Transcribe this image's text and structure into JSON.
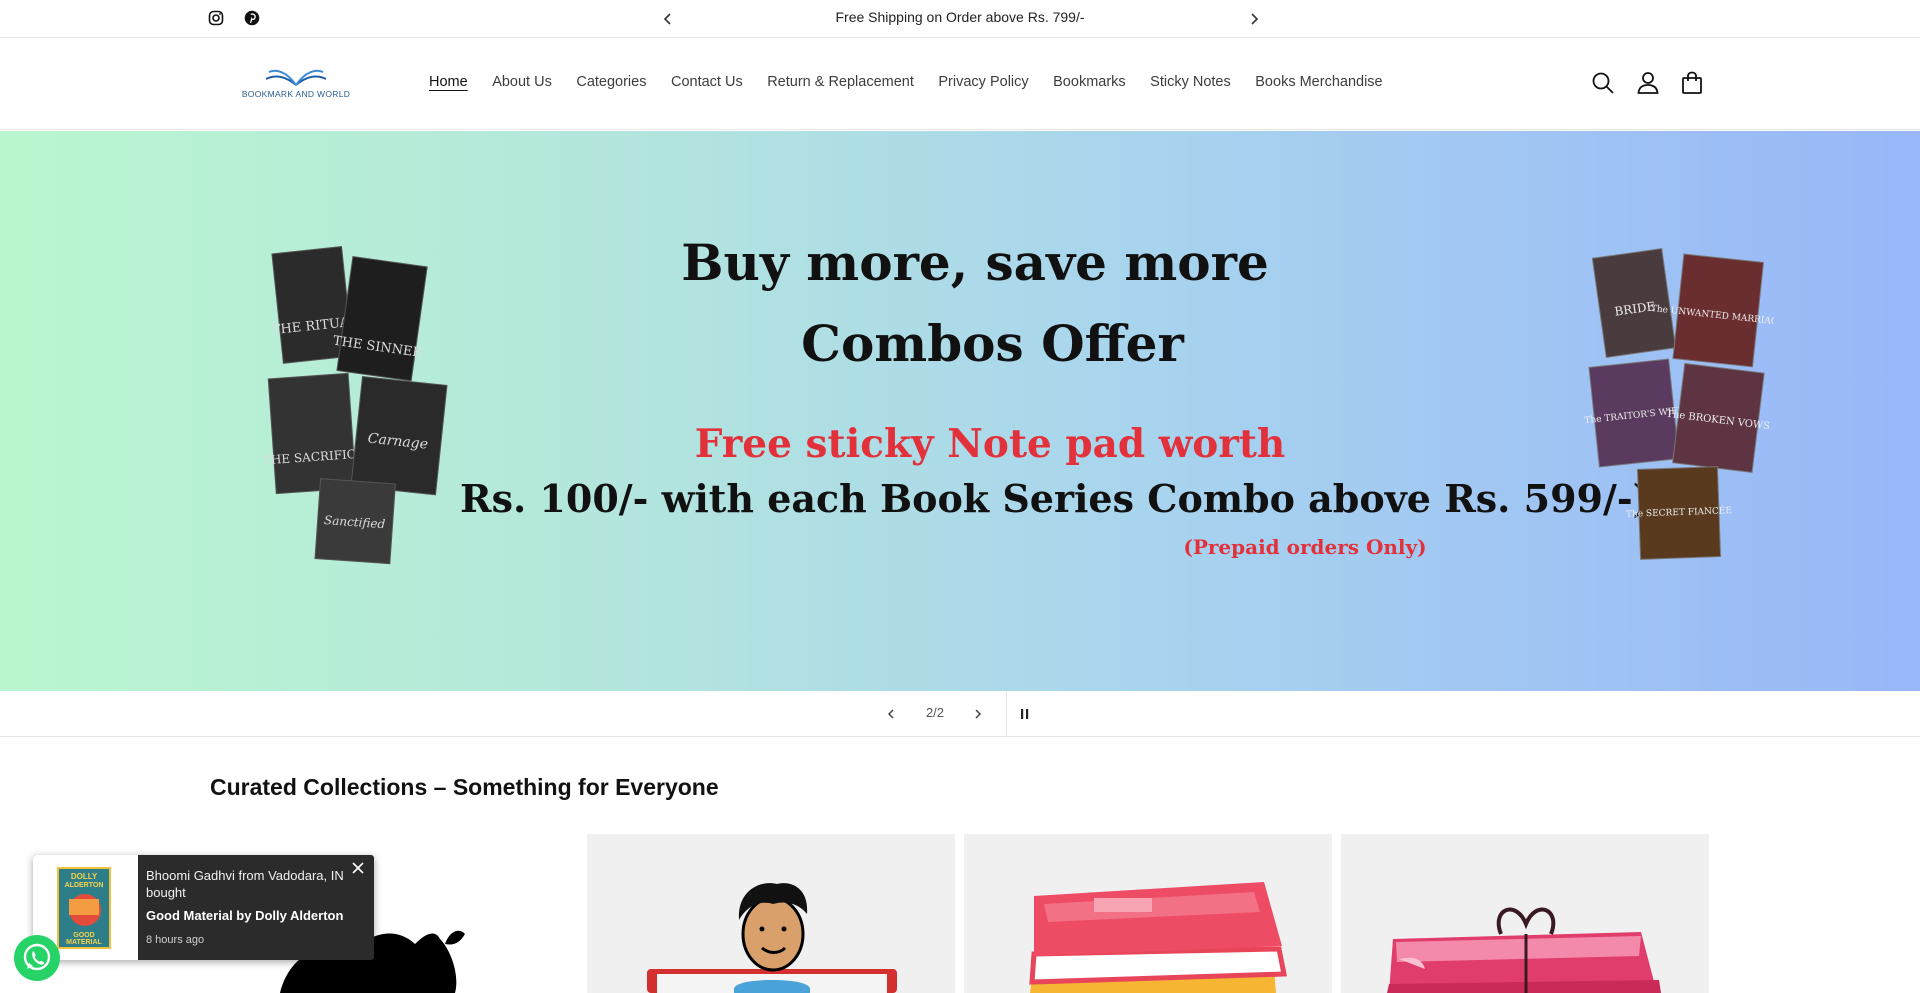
{
  "announcement": {
    "text": "Free Shipping on Order above Rs. 799/-",
    "social": [
      "instagram-icon",
      "pinterest-icon"
    ]
  },
  "header": {
    "logo_text": "BOOKMARK AND WORLD",
    "nav": [
      {
        "label": "Home",
        "active": true
      },
      {
        "label": "About Us"
      },
      {
        "label": "Categories"
      },
      {
        "label": "Contact Us"
      },
      {
        "label": "Return & Replacement"
      },
      {
        "label": "Privacy Policy"
      },
      {
        "label": "Bookmarks"
      },
      {
        "label": "Sticky Notes"
      },
      {
        "label": "Books Merchandise"
      }
    ],
    "icons": [
      "search-icon",
      "account-icon",
      "cart-icon"
    ]
  },
  "banner": {
    "line1": "Buy more, save more",
    "line2": "Combos Offer",
    "line3": "Free sticky Note pad worth",
    "line4": "Rs. 100/- with each Book Series Combo above Rs. 599/-)",
    "line5": "(Prepaid orders Only)",
    "left_books": [
      "THE RITUAL",
      "THE SINNER",
      "THE SACRIFICE",
      "Carnage",
      "Sanctified"
    ],
    "right_books": [
      "BRIDE",
      "The UNWANTED MARRIAGE",
      "The TRAITOR'S WIFE",
      "The BROKEN VOWS",
      "The SECRET FIANCÉE"
    ],
    "colors": {
      "gradient_start": "#b9f6cf",
      "gradient_end": "#98b6f8",
      "accent_red": "#e3313b"
    }
  },
  "slider": {
    "counter": "2/2"
  },
  "collections": {
    "title": "Curated Collections – Something for Everyone"
  },
  "sales_popup": {
    "line1": "Bhoomi Gadhvi from Vadodara, IN bought",
    "product": "Good Material by Dolly Alderton",
    "time": "8 hours ago",
    "cover_text": [
      "DOLLY",
      "ALDERTON",
      "GOOD",
      "MATERIAL"
    ]
  }
}
